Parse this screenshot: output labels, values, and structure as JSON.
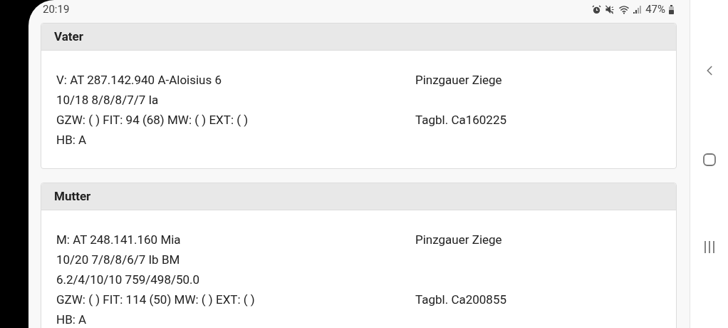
{
  "status_bar": {
    "time": "20:19",
    "battery": "47%"
  },
  "cards": [
    {
      "title": "Vater",
      "lines": [
        {
          "left": "V: AT 287.142.940 A-Aloisius 6",
          "right": "Pinzgauer Ziege"
        },
        {
          "left": "10/18 8/8/8/7/7 Ia"
        },
        {
          "left": "GZW: ( ) FIT: 94 (68) MW: ( ) EXT: ( )",
          "right": "Tagbl. Ca160225"
        },
        {
          "left": "HB: A"
        }
      ]
    },
    {
      "title": "Mutter",
      "lines": [
        {
          "left": "M: AT 248.141.160 Mia",
          "right": "Pinzgauer Ziege"
        },
        {
          "left": "10/20 7/8/8/6/7 Ib BM"
        },
        {
          "left": "6.2/4/10/10 759/498/50.0"
        },
        {
          "left": "GZW: ( ) FIT: 114 (50) MW: ( ) EXT: ( )",
          "right": "Tagbl. Ca200855"
        },
        {
          "left": "HB: A"
        }
      ]
    }
  ]
}
